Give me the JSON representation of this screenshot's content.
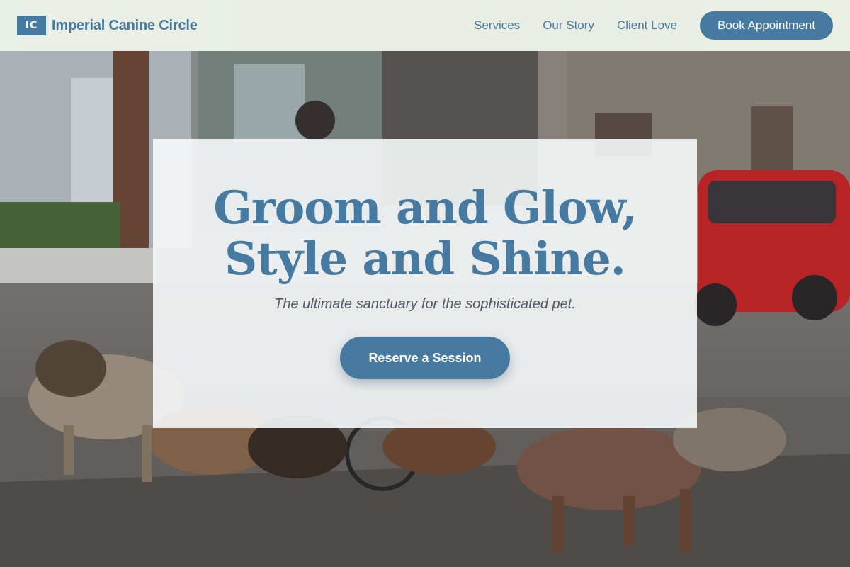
{
  "brand": {
    "mark": "IC",
    "name": "Imperial Canine Circle"
  },
  "nav": {
    "links": [
      "Services",
      "Our Story",
      "Client Love"
    ],
    "cta_label": "Book Appointment"
  },
  "hero": {
    "title_line1": "Groom and Glow,",
    "title_line2": "Style and Shine.",
    "subtitle": "The ultimate sanctuary for the sophisticated pet.",
    "cta_label": "Reserve a Session"
  },
  "colors": {
    "accent": "#467aa0",
    "nav_background": "#f0f6ec",
    "card_background": "#f6f8fa",
    "subtitle_text": "#505a66"
  }
}
